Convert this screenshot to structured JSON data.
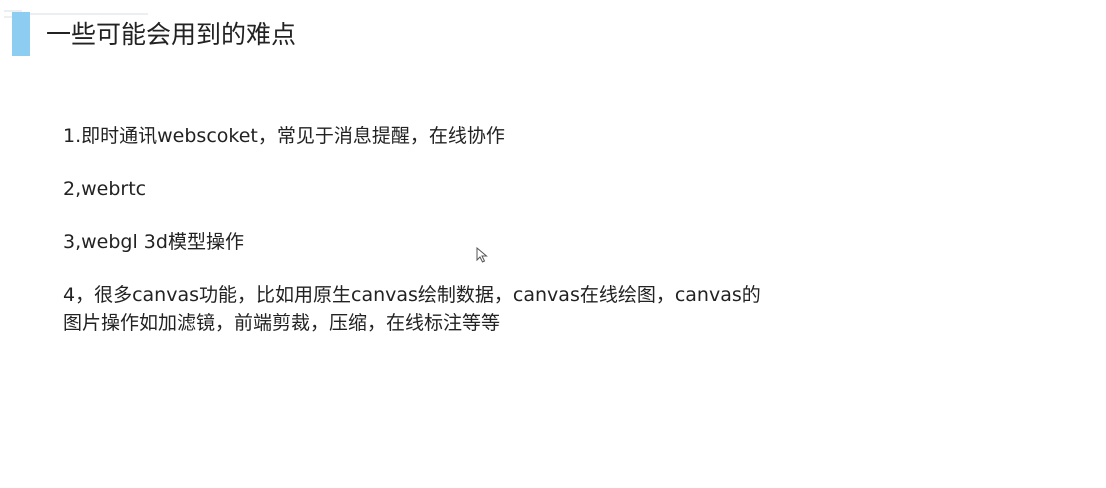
{
  "slide": {
    "title": "一些可能会用到的难点",
    "points": [
      "1.即时通讯webscoket，常见于消息提醒，在线协作",
      "2,webrtc",
      "3,webgl 3d模型操作",
      "4，很多canvas功能，比如用原生canvas绘制数据，canvas在线绘图，canvas的\n图片操作如加滤镜，前端剪裁，压缩，在线标注等等"
    ]
  },
  "colors": {
    "accent": "#8ecdf2",
    "text": "#222222",
    "background": "#ffffff"
  },
  "icons": {
    "cursor": "mouse-pointer-icon"
  }
}
